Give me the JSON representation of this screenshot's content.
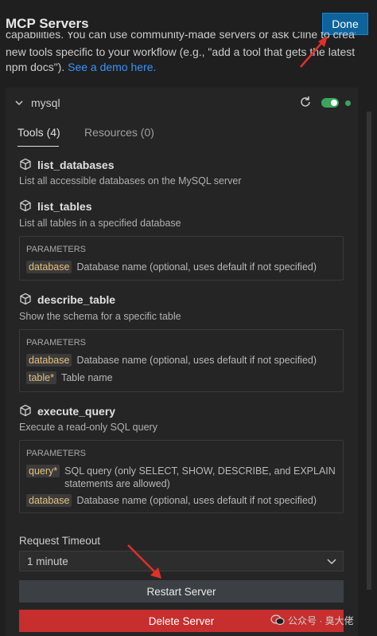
{
  "header": {
    "title": "MCP Servers",
    "done_label": "Done"
  },
  "intro": {
    "line1": "capabilities. You can use community-made servers or ask Cline to create",
    "line2": "new tools specific to your workflow (e.g., \"add a tool that gets the latest",
    "line3_text": "npm docs\"). ",
    "line3_link": "See a demo here."
  },
  "server": {
    "name": "mysql",
    "enabled": true,
    "status_color": "#3aa55d",
    "tabs": [
      {
        "label": "Tools (4)",
        "active": true
      },
      {
        "label": "Resources (0)",
        "active": false
      }
    ],
    "tools": [
      {
        "name": "list_databases",
        "description": "List all accessible databases on the MySQL server",
        "params_title": "",
        "params": []
      },
      {
        "name": "list_tables",
        "description": "List all tables in a specified database",
        "params_title": "PARAMETERS",
        "params": [
          {
            "name": "database",
            "desc": "Database name (optional, uses default if not specified)"
          }
        ]
      },
      {
        "name": "describe_table",
        "description": "Show the schema for a specific table",
        "params_title": "PARAMETERS",
        "params": [
          {
            "name": "database",
            "desc": "Database name (optional, uses default if not specified)"
          },
          {
            "name": "table*",
            "desc": "Table name"
          }
        ]
      },
      {
        "name": "execute_query",
        "description": "Execute a read-only SQL query",
        "params_title": "PARAMETERS",
        "params": [
          {
            "name": "query*",
            "desc": "SQL query (only SELECT, SHOW, DESCRIBE, and EXPLAIN",
            "desc2": "statements are allowed)"
          },
          {
            "name": "database",
            "desc": "Database name (optional, uses default if not specified)"
          }
        ]
      }
    ],
    "request_timeout_label": "Request Timeout",
    "request_timeout_value": "1 minute",
    "restart_label": "Restart Server",
    "delete_label": "Delete Server"
  },
  "icons": {
    "collapse": "chevron-down-icon",
    "refresh": "refresh-icon",
    "tool": "cube-icon",
    "dropdown": "chevron-down-icon"
  },
  "colors": {
    "accent": "#0e639c",
    "link": "#3794ff",
    "danger": "#c72e2e",
    "annotation_arrow": "#e0302a"
  },
  "watermark": "公众号 · 臭大佬"
}
